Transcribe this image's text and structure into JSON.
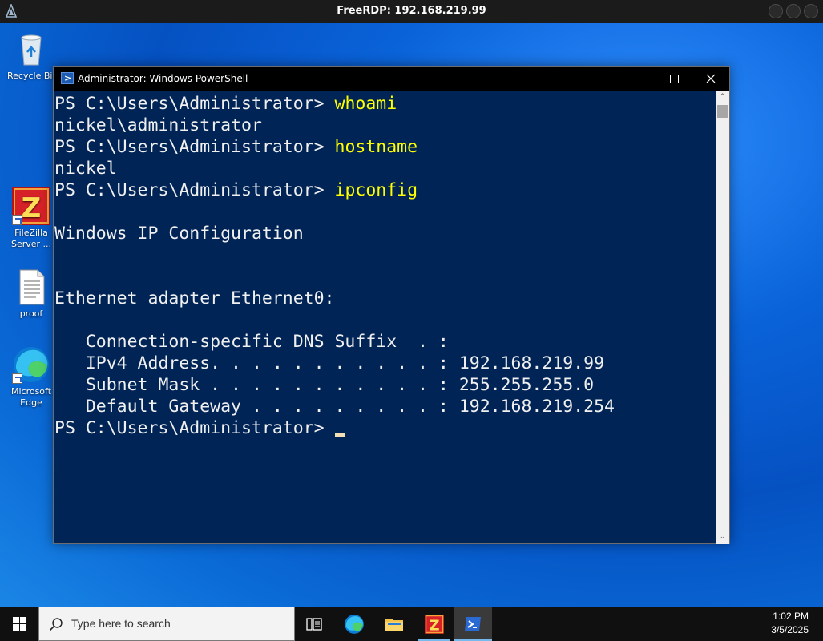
{
  "rdp": {
    "title": "FreeRDP: 192.168.219.99"
  },
  "desktop": {
    "icons": [
      {
        "label": "Recycle Bin"
      },
      {
        "label": "FileZilla Server ..."
      },
      {
        "label": "proof"
      },
      {
        "label": "Microsoft Edge"
      }
    ]
  },
  "window": {
    "title": "Administrator: Windows PowerShell",
    "prompt": "PS C:\\Users\\Administrator> ",
    "lines": [
      {
        "type": "prompt",
        "cmd": "whoami"
      },
      {
        "type": "out",
        "text": "nickel\\administrator"
      },
      {
        "type": "prompt",
        "cmd": "hostname"
      },
      {
        "type": "out",
        "text": "nickel"
      },
      {
        "type": "prompt",
        "cmd": "ipconfig"
      },
      {
        "type": "out",
        "text": ""
      },
      {
        "type": "out",
        "text": "Windows IP Configuration"
      },
      {
        "type": "out",
        "text": ""
      },
      {
        "type": "out",
        "text": ""
      },
      {
        "type": "out",
        "text": "Ethernet adapter Ethernet0:"
      },
      {
        "type": "out",
        "text": ""
      },
      {
        "type": "out",
        "text": "   Connection-specific DNS Suffix  . :"
      },
      {
        "type": "out",
        "text": "   IPv4 Address. . . . . . . . . . . : 192.168.219.99"
      },
      {
        "type": "out",
        "text": "   Subnet Mask . . . . . . . . . . . : 255.255.255.0"
      },
      {
        "type": "out",
        "text": "   Default Gateway . . . . . . . . . : 192.168.219.254"
      },
      {
        "type": "prompt",
        "cmd": "",
        "cursor": true
      }
    ]
  },
  "taskbar": {
    "search_placeholder": "Type here to search",
    "time": "1:02 PM",
    "date": "3/5/2025"
  },
  "colors": {
    "console_bg": "#012456",
    "console_text": "#f0f0f0",
    "command_text": "#ffff00",
    "taskbar_bg": "#101010"
  }
}
